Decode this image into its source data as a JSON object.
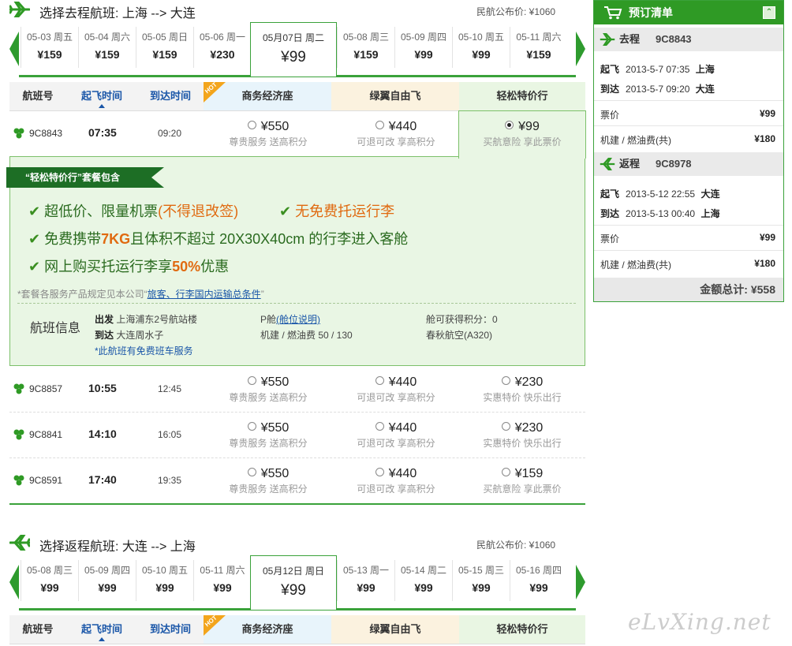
{
  "outbound": {
    "title": "选择去程航班: 上海 --> 大连",
    "official_price": "民航公布价: ¥1060",
    "days": [
      {
        "date": "05-03 周五",
        "price": "¥159"
      },
      {
        "date": "05-04 周六",
        "price": "¥159"
      },
      {
        "date": "05-05 周日",
        "price": "¥159"
      },
      {
        "date": "05-06 周一",
        "price": "¥230"
      },
      {
        "date": "05月07日 周二",
        "price": "¥99",
        "selected": true
      },
      {
        "date": "05-08 周三",
        "price": "¥159"
      },
      {
        "date": "05-09 周四",
        "price": "¥99"
      },
      {
        "date": "05-10 周五",
        "price": "¥99"
      },
      {
        "date": "05-11 周六",
        "price": "¥159"
      }
    ],
    "headers": [
      "航班号",
      "起飞时间",
      "到达时间",
      "商务经济座",
      "绿翼自由飞",
      "轻松特价行"
    ],
    "hot": "HOT",
    "flights": [
      {
        "no": "9C8843",
        "dep": "07:35",
        "arr": "09:20",
        "f1": "¥550",
        "f1s": "尊贵服务 送高积分",
        "f2": "¥440",
        "f2s": "可退可改 享高积分",
        "f3": "¥99",
        "f3s": "买航意险 享此票价"
      },
      {
        "no": "9C8857",
        "dep": "10:55",
        "arr": "12:45",
        "f1": "¥550",
        "f1s": "尊贵服务 送高积分",
        "f2": "¥440",
        "f2s": "可退可改 享高积分",
        "f3": "¥230",
        "f3s": "实惠特价 快乐出行"
      },
      {
        "no": "9C8841",
        "dep": "14:10",
        "arr": "16:05",
        "f1": "¥550",
        "f1s": "尊贵服务 送高积分",
        "f2": "¥440",
        "f2s": "可退可改 享高积分",
        "f3": "¥230",
        "f3s": "实惠特价 快乐出行"
      },
      {
        "no": "9C8591",
        "dep": "17:40",
        "arr": "19:35",
        "f1": "¥550",
        "f1s": "尊贵服务 送高积分",
        "f2": "¥440",
        "f2s": "可退可改 享高积分",
        "f3": "¥159",
        "f3s": "买航意险 享此票价"
      }
    ],
    "package": {
      "ribbon": "“轻松特价行”套餐包含",
      "l1a": "超低价、限量机票",
      "l1b": "(不得退改签)",
      "l1c": "无免费托运行李",
      "l2a": "免费携带",
      "l2b": "7KG",
      "l2c": "且体积不超过 20X30X40cm 的行李进入客舱",
      "l3a": "网上购买托运行李享",
      "l3b": "50%",
      "l3c": "优惠",
      "note_pre": "*套餐各服务产品规定见本公司“",
      "note_link": "旅客、行李国内运输总条件",
      "note_post": "”",
      "info_title": "航班信息",
      "dep_label": "出发",
      "dep_val": "上海浦东2号航站楼",
      "arr_label": "到达",
      "arr_val": "大连周水子",
      "shuttle": "*此航班有免费班车服务",
      "cabin": "P舱",
      "cabin_link": "(舱位说明)",
      "fee": "机建 / 燃油费 50 / 130",
      "points": "舱可获得积分：0",
      "aircraft": "春秋航空(A320)"
    }
  },
  "return": {
    "title": "选择返程航班: 大连 --> 上海",
    "official_price": "民航公布价: ¥1060",
    "days": [
      {
        "date": "05-08 周三",
        "price": "¥99"
      },
      {
        "date": "05-09 周四",
        "price": "¥99"
      },
      {
        "date": "05-10 周五",
        "price": "¥99"
      },
      {
        "date": "05-11 周六",
        "price": "¥99"
      },
      {
        "date": "05月12日 周日",
        "price": "¥99",
        "selected": true
      },
      {
        "date": "05-13 周一",
        "price": "¥99"
      },
      {
        "date": "05-14 周二",
        "price": "¥99"
      },
      {
        "date": "05-15 周三",
        "price": "¥99"
      },
      {
        "date": "05-16 周四",
        "price": "¥99"
      }
    ],
    "headers": [
      "航班号",
      "起飞时间",
      "到达时间",
      "商务经济座",
      "绿翼自由飞",
      "轻松特价行"
    ],
    "hot": "HOT"
  },
  "cart": {
    "title": "预订清单",
    "toggle": "⌃",
    "go_label": "去程",
    "go_no": "9C8843",
    "go_dep_label": "起飞",
    "go_dep": "2013-5-7 07:35",
    "go_dep_city": "上海",
    "go_arr_label": "到达",
    "go_arr": "2013-5-7 09:20",
    "go_arr_city": "大连",
    "ticket_label": "票价",
    "go_price": "¥99",
    "fee_label": "机建 / 燃油费(共)",
    "go_fee": "¥180",
    "back_label": "返程",
    "back_no": "9C8978",
    "back_dep": "2013-5-12 22:55",
    "back_dep_city": "大连",
    "back_arr": "2013-5-13 00:40",
    "back_arr_city": "上海",
    "back_price": "¥99",
    "back_fee": "¥180",
    "total": "金额总计: ¥558"
  },
  "watermark": "eLvXing.net",
  "colors": {
    "brand_green": "#2f9a25",
    "link_blue": "#1a56a8",
    "orange": "#e06a10"
  }
}
